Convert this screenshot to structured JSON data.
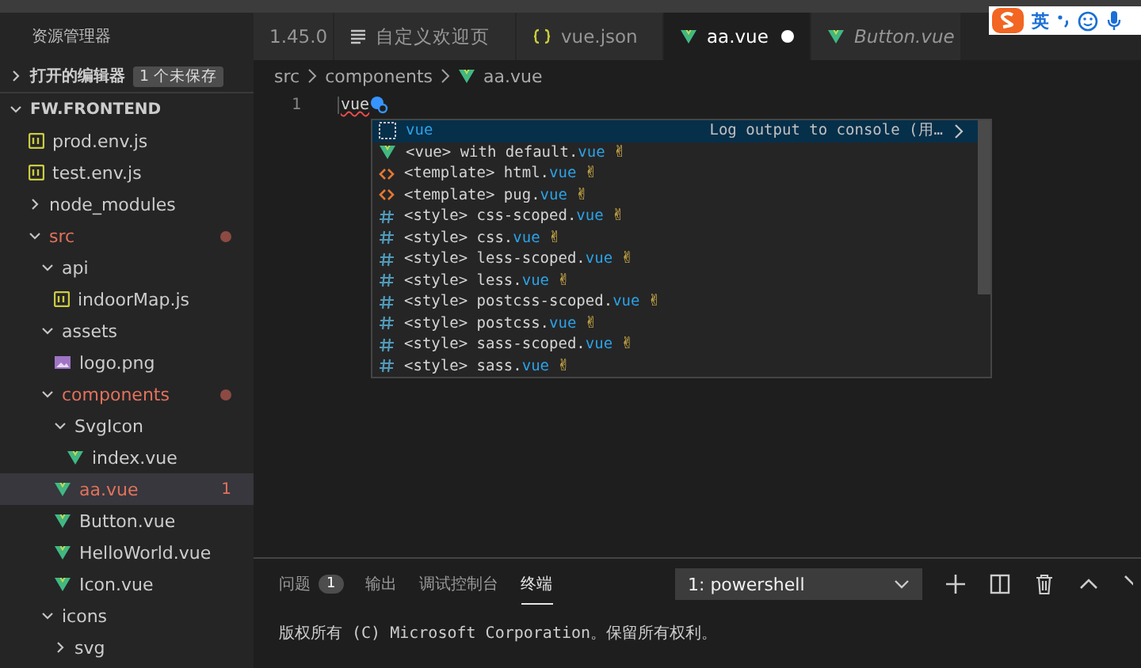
{
  "explorer": {
    "title": "资源管理器",
    "open_editors": {
      "label": "打开的编辑器",
      "badge": "1 个未保存",
      "expanded": false
    },
    "root": {
      "label": "FW.FRONTEND",
      "expanded": true
    },
    "tree": [
      {
        "kind": "js",
        "label": "prod.env.js",
        "selected": false
      },
      {
        "kind": "js",
        "label": "test.env.js",
        "selected": false
      },
      {
        "kind": "folder",
        "label": "node_modules",
        "expanded": false,
        "selected": false
      },
      {
        "kind": "folder",
        "label": "src",
        "expanded": true,
        "modified": true,
        "error": true,
        "selected": false,
        "children": [
          {
            "kind": "folder",
            "label": "api",
            "expanded": true,
            "selected": false,
            "children": [
              {
                "kind": "js",
                "label": "indoorMap.js",
                "selected": false
              }
            ]
          },
          {
            "kind": "folder",
            "label": "assets",
            "expanded": true,
            "selected": false,
            "children": [
              {
                "kind": "image",
                "label": "logo.png",
                "selected": false
              }
            ]
          },
          {
            "kind": "folder",
            "label": "components",
            "expanded": true,
            "modified": true,
            "error": true,
            "selected": false,
            "children": [
              {
                "kind": "folder",
                "label": "SvgIcon",
                "expanded": true,
                "selected": false,
                "children": [
                  {
                    "kind": "vue",
                    "label": "index.vue",
                    "selected": false
                  }
                ]
              },
              {
                "kind": "vue",
                "label": "aa.vue",
                "selected": true,
                "error": true,
                "badge": "1"
              },
              {
                "kind": "vue",
                "label": "Button.vue",
                "selected": false
              },
              {
                "kind": "vue",
                "label": "HelloWorld.vue",
                "selected": false
              },
              {
                "kind": "vue",
                "label": "Icon.vue",
                "selected": false
              }
            ]
          },
          {
            "kind": "folder",
            "label": "icons",
            "expanded": true,
            "selected": false,
            "children": [
              {
                "kind": "folder",
                "label": "svg",
                "expanded": false,
                "selected": false
              }
            ]
          }
        ]
      }
    ]
  },
  "tabs": [
    {
      "kind": "plain",
      "label": "1.45.0",
      "selected": false
    },
    {
      "kind": "preview",
      "label": "自定义欢迎页",
      "selected": false
    },
    {
      "kind": "json",
      "label": "vue.json",
      "selected": false
    },
    {
      "kind": "vue",
      "label": "aa.vue",
      "selected": true,
      "dirty": true
    },
    {
      "kind": "vue",
      "label": "Button.vue",
      "selected": false,
      "italic": true
    }
  ],
  "breadcrumb": [
    "src",
    "components",
    "aa.vue"
  ],
  "code": {
    "line_number": "1",
    "text": "vue"
  },
  "suggestions": [
    {
      "kind": "snippet",
      "match": "vue",
      "detail": "Log output to console (用…",
      "selected": true
    },
    {
      "kind": "vue",
      "text": "<vue> with default.",
      "match": "vue",
      "emoji": "✌",
      "selected": false
    },
    {
      "kind": "template",
      "text": "<template> html.",
      "match": "vue",
      "emoji": "✌",
      "selected": false
    },
    {
      "kind": "template",
      "text": "<template> pug.",
      "match": "vue",
      "emoji": "✌",
      "selected": false
    },
    {
      "kind": "style",
      "text": "<style> css-scoped.",
      "match": "vue",
      "emoji": "✌",
      "selected": false
    },
    {
      "kind": "style",
      "text": "<style> css.",
      "match": "vue",
      "emoji": "✌",
      "selected": false
    },
    {
      "kind": "style",
      "text": "<style> less-scoped.",
      "match": "vue",
      "emoji": "✌",
      "selected": false
    },
    {
      "kind": "style",
      "text": "<style> less.",
      "match": "vue",
      "emoji": "✌",
      "selected": false
    },
    {
      "kind": "style",
      "text": "<style> postcss-scoped.",
      "match": "vue",
      "emoji": "✌",
      "selected": false
    },
    {
      "kind": "style",
      "text": "<style> postcss.",
      "match": "vue",
      "emoji": "✌",
      "selected": false
    },
    {
      "kind": "style",
      "text": "<style> sass-scoped.",
      "match": "vue",
      "emoji": "✌",
      "selected": false
    },
    {
      "kind": "style",
      "text": "<style> sass.",
      "match": "vue",
      "emoji": "✌",
      "selected": false
    }
  ],
  "panel": {
    "tabs": [
      {
        "label": "问题",
        "badge": "1",
        "selected": false
      },
      {
        "label": "输出",
        "selected": false
      },
      {
        "label": "调试控制台",
        "selected": false
      },
      {
        "label": "终端",
        "selected": true
      }
    ],
    "terminal_select": "1: powershell",
    "terminal_text": "版权所有 (C) Microsoft Corporation。保留所有权利。"
  },
  "ime_toolbar": {
    "mode": "英"
  }
}
